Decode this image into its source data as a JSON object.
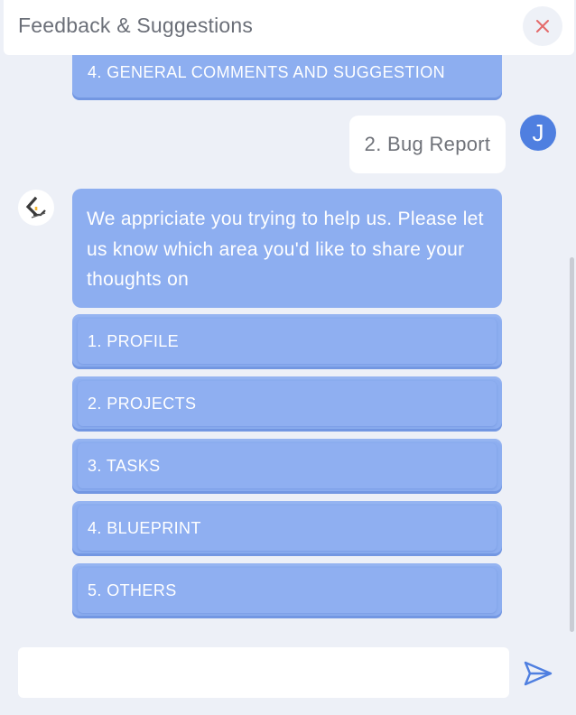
{
  "header": {
    "title": "Feedback & Suggestions"
  },
  "messages": {
    "prev_option": "4. GENERAL COMMENTS AND SUGGESTION",
    "user_reply": "2. Bug Report",
    "user_avatar_initial": "J",
    "bot_text": "We appriciate you trying to help us. Please let us know which area you'd like to share your thoughts on",
    "options": [
      "1. PROFILE",
      "2. PROJECTS",
      "3. TASKS",
      "4. BLUEPRINT",
      "5. OTHERS"
    ]
  },
  "composer": {
    "placeholder": ""
  },
  "colors": {
    "accent": "#8daef0",
    "avatar": "#4f7fe0",
    "close": "#e46a6a",
    "send": "#4f7fe0"
  }
}
